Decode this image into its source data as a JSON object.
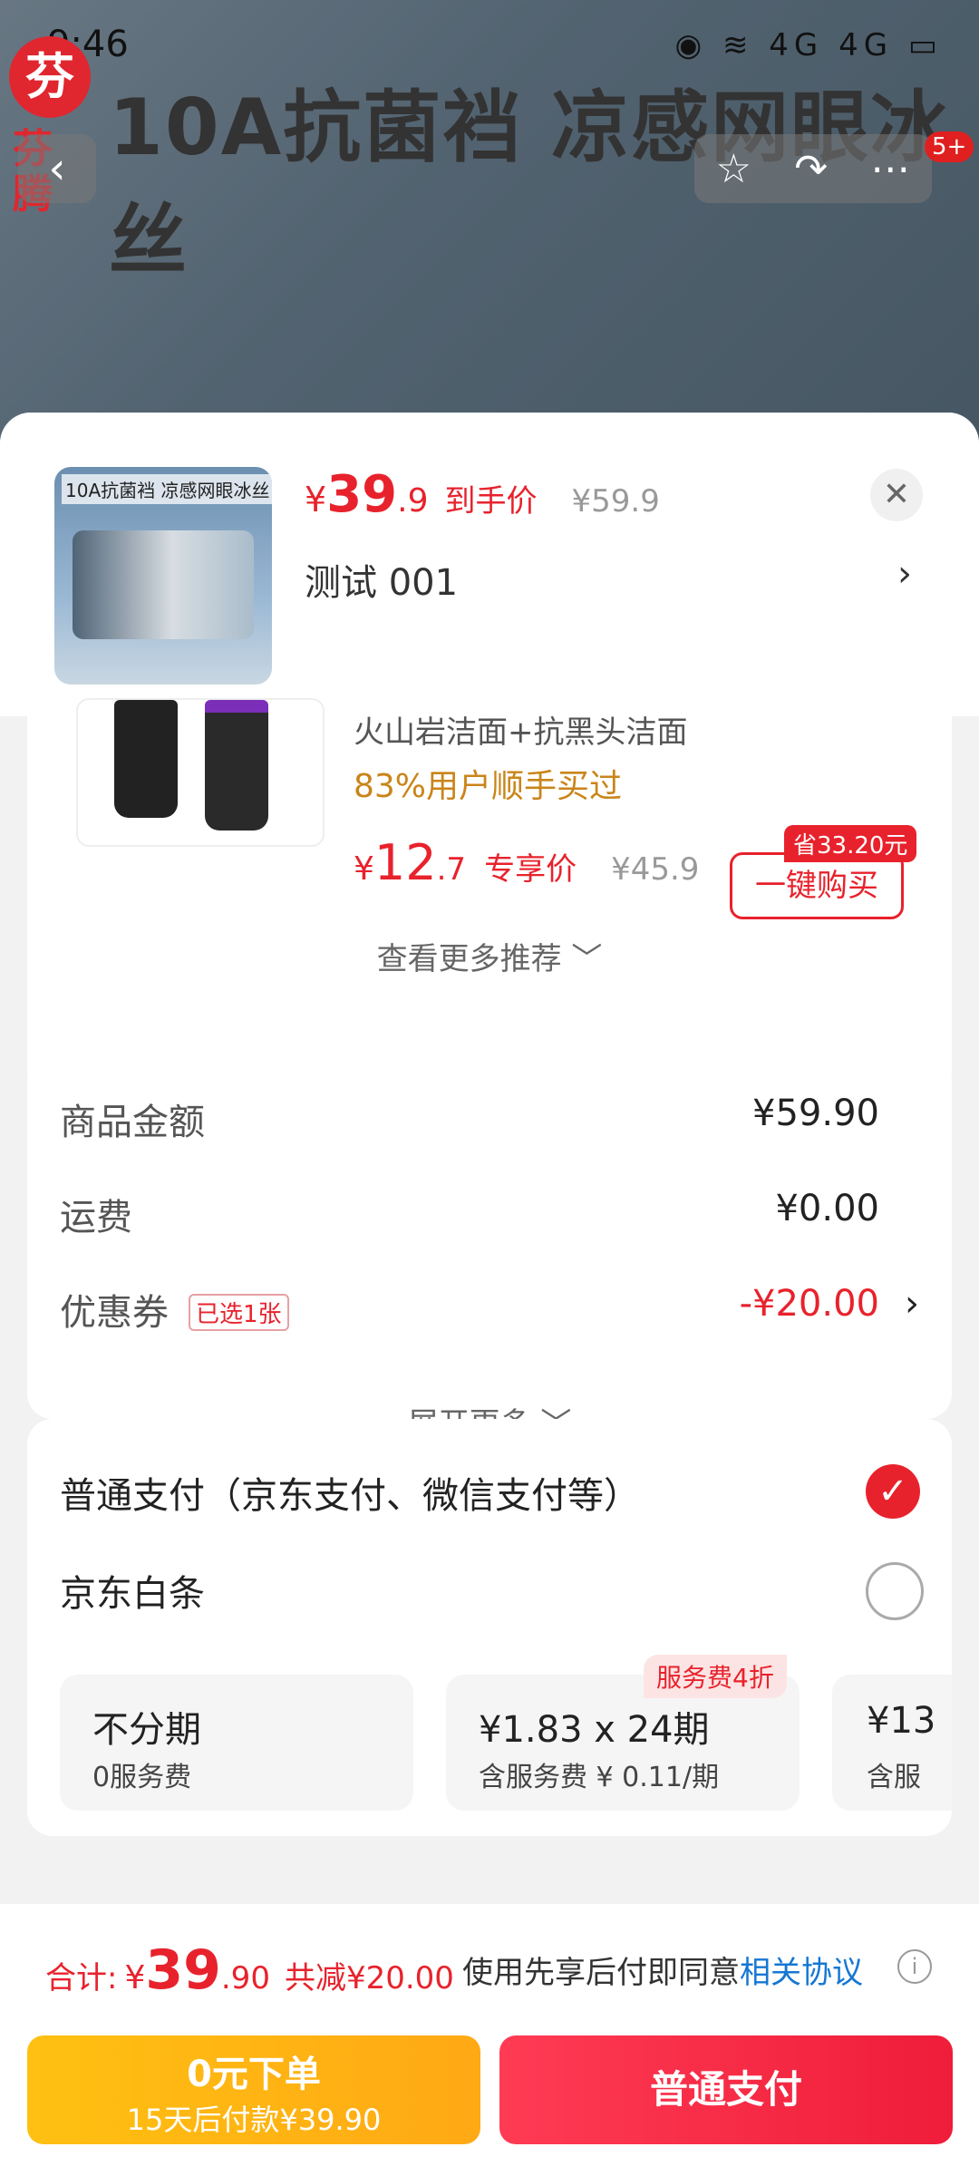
{
  "status_bar": {
    "time": "9:46",
    "icons": "◉ ≋ 4G 4G ▭"
  },
  "banner": {
    "brand_mark": "芬",
    "brand_name": "芬腾",
    "title": "10A抗菌裆 凉感网眼冰丝",
    "badge": "5+"
  },
  "sheet": {
    "thumb_title": "10A抗菌裆 凉感网眼冰丝",
    "price": {
      "currency": "¥",
      "int": "39",
      "dec": ".9",
      "tag": "到手价",
      "original": "¥59.9"
    },
    "spec": "测试  001",
    "close": "✕",
    "chevron": "›"
  },
  "recommendation": {
    "subtitle": "火山岩洁面+抗黑头洁面",
    "bought": "83%用户顺手买过",
    "price": {
      "currency": "¥",
      "int": "12",
      "dec": ".7",
      "tag": "专享价",
      "original": "¥45.9"
    },
    "save_badge": "省33.20元",
    "buy_label": "一键购买",
    "more": "查看更多推荐 ﹀"
  },
  "cost": {
    "rows": [
      {
        "label": "商品金额",
        "value": "¥59.90"
      },
      {
        "label": "运费",
        "value": "¥0.00"
      },
      {
        "label": "优惠券",
        "value": "-¥20.00"
      }
    ],
    "coupon_badge": "已选1张",
    "expand": "展开更多 ﹀"
  },
  "payment": {
    "option_normal": "普通支付（京东支付、微信支付等）",
    "option_baitiao": "京东白条",
    "plans": [
      {
        "main": "不分期",
        "sub": "0服务费",
        "badge": ""
      },
      {
        "main": "¥1.83 x 24期",
        "sub": "含服务费 ¥ 0.11/期",
        "badge": "服务费4折"
      },
      {
        "main": "¥13",
        "sub": "含服",
        "badge": ""
      }
    ]
  },
  "footer": {
    "total_label": "合计:",
    "total_currency": "¥",
    "total_int": "39",
    "total_dec": ".90",
    "total_saved": "共减¥20.00",
    "agree_text": "使用先享后付即同意",
    "agree_link": "相关协议",
    "info_icon": "i",
    "btn_later_main": "0元下单",
    "btn_later_sub": "15天后付款¥39.90",
    "btn_pay": "普通支付"
  }
}
